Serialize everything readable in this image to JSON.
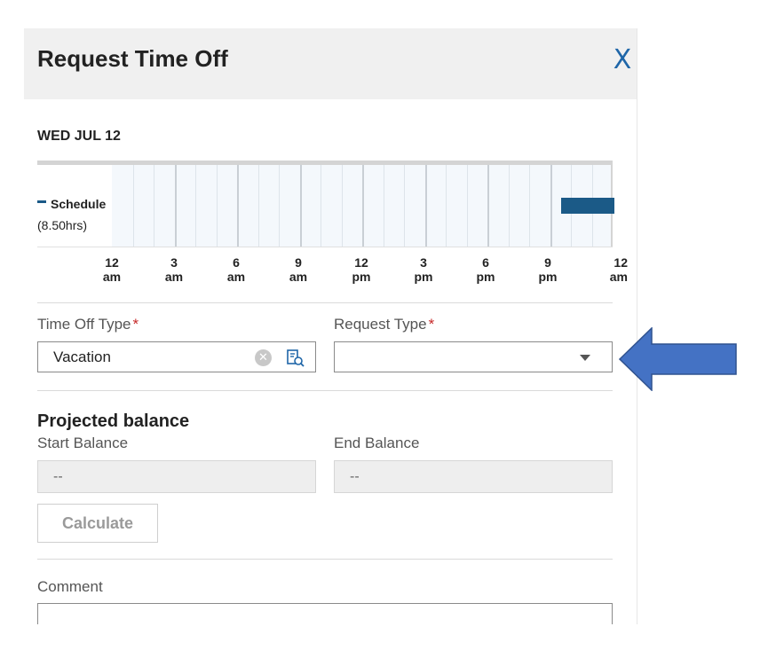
{
  "header": {
    "title": "Request Time Off",
    "close_label": "X"
  },
  "schedule": {
    "date": "WED JUL 12",
    "legend_label": "Schedule",
    "legend_hours": "(8.50hrs)",
    "ticks": [
      {
        "num": "12",
        "ampm": "am"
      },
      {
        "num": "3",
        "ampm": "am"
      },
      {
        "num": "6",
        "ampm": "am"
      },
      {
        "num": "9",
        "ampm": "am"
      },
      {
        "num": "12",
        "ampm": "pm"
      },
      {
        "num": "3",
        "ampm": "pm"
      },
      {
        "num": "6",
        "ampm": "pm"
      },
      {
        "num": "9",
        "ampm": "pm"
      },
      {
        "num": "12",
        "ampm": "am"
      }
    ],
    "color": "#1b5a87"
  },
  "form": {
    "time_off_type": {
      "label": "Time Off Type",
      "required": "*",
      "value": "Vacation"
    },
    "request_type": {
      "label": "Request Type",
      "required": "*",
      "value": ""
    },
    "projected_title": "Projected balance",
    "start_balance": {
      "label": "Start Balance",
      "value": "--"
    },
    "end_balance": {
      "label": "End Balance",
      "value": "--"
    },
    "calculate_label": "Calculate",
    "comment_label": "Comment"
  },
  "icons": {
    "close": "close-icon",
    "clear": "clear-circle-icon",
    "lookup": "lookup-search-icon",
    "dropdown": "chevron-down-icon",
    "annotation": "arrow-left-icon"
  },
  "colors": {
    "accent": "#1f66a8",
    "required": "#c62828",
    "annotation_arrow": "#4472c4"
  }
}
